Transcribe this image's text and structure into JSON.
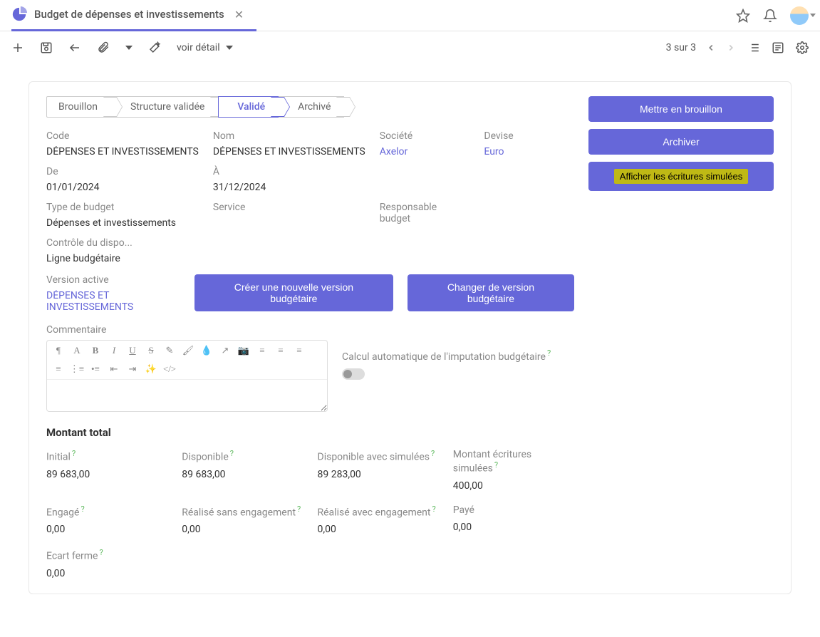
{
  "tab": {
    "title": "Budget de dépenses et investissements"
  },
  "toolbar": {
    "view_label": "voir détail",
    "pager": "3 sur 3"
  },
  "status": {
    "s1": "Brouillon",
    "s2": "Structure validée",
    "s3": "Validé",
    "s4": "Archivé"
  },
  "actions": {
    "draft": "Mettre en brouillon",
    "archive": "Archiver",
    "simulated": "Afficher les écritures simulées",
    "new_version": "Créer une nouvelle version budgétaire",
    "change_version": "Changer de version budgétaire"
  },
  "fields": {
    "code_label": "Code",
    "code_value": "DÉPENSES ET INVESTISSEMENTS",
    "name_label": "Nom",
    "name_value": "DÉPENSES ET INVESTISSEMENTS",
    "company_label": "Société",
    "company_value": "Axelor",
    "currency_label": "Devise",
    "currency_value": "Euro",
    "from_label": "De",
    "from_value": "01/01/2024",
    "to_label": "À",
    "to_value": "31/12/2024",
    "type_label": "Type de budget",
    "type_value": "Dépenses et investissements",
    "service_label": "Service",
    "respo_label": "Responsable budget",
    "control_label": "Contrôle du dispo...",
    "control_value": "Ligne budgétaire",
    "version_label": "Version active",
    "version_value": "DÉPENSES ET INVESTISSEMENTS",
    "comment_label": "Commentaire",
    "auto_calc_label": "Calcul automatique de l'imputation budgétaire"
  },
  "totals": {
    "title": "Montant total",
    "initial_label": "Initial",
    "initial_value": "89 683,00",
    "disponible_label": "Disponible",
    "disponible_value": "89 683,00",
    "dispo_sim_label": "Disponible avec simulées",
    "dispo_sim_value": "89 283,00",
    "montant_sim_label": "Montant écritures simulées",
    "montant_sim_value": "400,00",
    "engage_label": "Engagé",
    "engage_value": "0,00",
    "real_sans_label": "Réalisé sans engagement",
    "real_sans_value": "0,00",
    "real_avec_label": "Réalisé avec engagement",
    "real_avec_value": "0,00",
    "paye_label": "Payé",
    "paye_value": "0,00",
    "ecart_label": "Ecart ferme",
    "ecart_value": "0,00"
  }
}
